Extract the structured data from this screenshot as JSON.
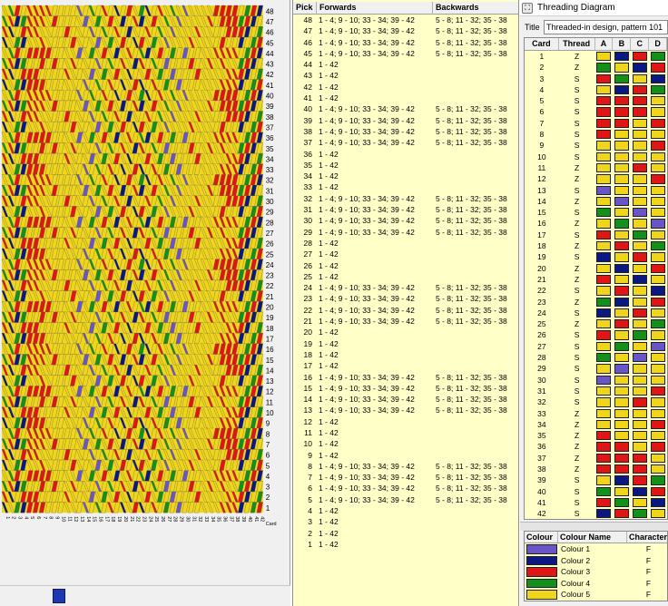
{
  "app": {
    "window_title": "Threading Diagram"
  },
  "colors": {
    "colour_1": "#6a55c8",
    "colour_2": "#0b1782",
    "colour_3": "#e01616",
    "colour_4": "#13901a",
    "colour_5": "#efd61c"
  },
  "pattern": {
    "row_numbers": [
      48,
      47,
      46,
      45,
      44,
      43,
      42,
      41,
      40,
      39,
      38,
      37,
      36,
      35,
      34,
      33,
      32,
      31,
      30,
      29,
      28,
      27,
      26,
      25,
      24,
      23,
      22,
      21,
      20,
      19,
      18,
      17,
      16,
      15,
      14,
      13,
      12,
      11,
      10,
      9,
      8,
      7,
      6,
      5,
      4,
      3,
      2,
      1
    ],
    "card_label": "Card"
  },
  "pick_table": {
    "headers": {
      "pick": "Pick",
      "forwards": "Forwards",
      "backwards": "Backwards"
    },
    "rows": [
      {
        "pick": "48",
        "forwards": "1 - 4; 9 - 10; 33 - 34; 39 - 42",
        "backwards": "5 - 8; 11 - 32; 35 - 38"
      },
      {
        "pick": "47",
        "forwards": "1 - 4; 9 - 10; 33 - 34; 39 - 42",
        "backwards": "5 - 8; 11 - 32; 35 - 38"
      },
      {
        "pick": "46",
        "forwards": "1 - 4; 9 - 10; 33 - 34; 39 - 42",
        "backwards": "5 - 8; 11 - 32; 35 - 38"
      },
      {
        "pick": "45",
        "forwards": "1 - 4; 9 - 10; 33 - 34; 39 - 42",
        "backwards": "5 - 8; 11 - 32; 35 - 38"
      },
      {
        "pick": "44",
        "forwards": "1 - 42",
        "backwards": ""
      },
      {
        "pick": "43",
        "forwards": "1 - 42",
        "backwards": ""
      },
      {
        "pick": "42",
        "forwards": "1 - 42",
        "backwards": ""
      },
      {
        "pick": "41",
        "forwards": "1 - 42",
        "backwards": ""
      },
      {
        "pick": "40",
        "forwards": "1 - 4; 9 - 10; 33 - 34; 39 - 42",
        "backwards": "5 - 8; 11 - 32; 35 - 38"
      },
      {
        "pick": "39",
        "forwards": "1 - 4; 9 - 10; 33 - 34; 39 - 42",
        "backwards": "5 - 8; 11 - 32; 35 - 38"
      },
      {
        "pick": "38",
        "forwards": "1 - 4; 9 - 10; 33 - 34; 39 - 42",
        "backwards": "5 - 8; 11 - 32; 35 - 38"
      },
      {
        "pick": "37",
        "forwards": "1 - 4; 9 - 10; 33 - 34; 39 - 42",
        "backwards": "5 - 8; 11 - 32; 35 - 38"
      },
      {
        "pick": "36",
        "forwards": "1 - 42",
        "backwards": ""
      },
      {
        "pick": "35",
        "forwards": "1 - 42",
        "backwards": ""
      },
      {
        "pick": "34",
        "forwards": "1 - 42",
        "backwards": ""
      },
      {
        "pick": "33",
        "forwards": "1 - 42",
        "backwards": ""
      },
      {
        "pick": "32",
        "forwards": "1 - 4; 9 - 10; 33 - 34; 39 - 42",
        "backwards": "5 - 8; 11 - 32; 35 - 38"
      },
      {
        "pick": "31",
        "forwards": "1 - 4; 9 - 10; 33 - 34; 39 - 42",
        "backwards": "5 - 8; 11 - 32; 35 - 38"
      },
      {
        "pick": "30",
        "forwards": "1 - 4; 9 - 10; 33 - 34; 39 - 42",
        "backwards": "5 - 8; 11 - 32; 35 - 38"
      },
      {
        "pick": "29",
        "forwards": "1 - 4; 9 - 10; 33 - 34; 39 - 42",
        "backwards": "5 - 8; 11 - 32; 35 - 38"
      },
      {
        "pick": "28",
        "forwards": "1 - 42",
        "backwards": ""
      },
      {
        "pick": "27",
        "forwards": "1 - 42",
        "backwards": ""
      },
      {
        "pick": "26",
        "forwards": "1 - 42",
        "backwards": ""
      },
      {
        "pick": "25",
        "forwards": "1 - 42",
        "backwards": ""
      },
      {
        "pick": "24",
        "forwards": "1 - 4; 9 - 10; 33 - 34; 39 - 42",
        "backwards": "5 - 8; 11 - 32; 35 - 38"
      },
      {
        "pick": "23",
        "forwards": "1 - 4; 9 - 10; 33 - 34; 39 - 42",
        "backwards": "5 - 8; 11 - 32; 35 - 38"
      },
      {
        "pick": "22",
        "forwards": "1 - 4; 9 - 10; 33 - 34; 39 - 42",
        "backwards": "5 - 8; 11 - 32; 35 - 38"
      },
      {
        "pick": "21",
        "forwards": "1 - 4; 9 - 10; 33 - 34; 39 - 42",
        "backwards": "5 - 8; 11 - 32; 35 - 38"
      },
      {
        "pick": "20",
        "forwards": "1 - 42",
        "backwards": ""
      },
      {
        "pick": "19",
        "forwards": "1 - 42",
        "backwards": ""
      },
      {
        "pick": "18",
        "forwards": "1 - 42",
        "backwards": ""
      },
      {
        "pick": "17",
        "forwards": "1 - 42",
        "backwards": ""
      },
      {
        "pick": "16",
        "forwards": "1 - 4; 9 - 10; 33 - 34; 39 - 42",
        "backwards": "5 - 8; 11 - 32; 35 - 38"
      },
      {
        "pick": "15",
        "forwards": "1 - 4; 9 - 10; 33 - 34; 39 - 42",
        "backwards": "5 - 8; 11 - 32; 35 - 38"
      },
      {
        "pick": "14",
        "forwards": "1 - 4; 9 - 10; 33 - 34; 39 - 42",
        "backwards": "5 - 8; 11 - 32; 35 - 38"
      },
      {
        "pick": "13",
        "forwards": "1 - 4; 9 - 10; 33 - 34; 39 - 42",
        "backwards": "5 - 8; 11 - 32; 35 - 38"
      },
      {
        "pick": "12",
        "forwards": "1 - 42",
        "backwards": ""
      },
      {
        "pick": "11",
        "forwards": "1 - 42",
        "backwards": ""
      },
      {
        "pick": "10",
        "forwards": "1 - 42",
        "backwards": ""
      },
      {
        "pick": "9",
        "forwards": "1 - 42",
        "backwards": ""
      },
      {
        "pick": "8",
        "forwards": "1 - 4; 9 - 10; 33 - 34; 39 - 42",
        "backwards": "5 - 8; 11 - 32; 35 - 38"
      },
      {
        "pick": "7",
        "forwards": "1 - 4; 9 - 10; 33 - 34; 39 - 42",
        "backwards": "5 - 8; 11 - 32; 35 - 38"
      },
      {
        "pick": "6",
        "forwards": "1 - 4; 9 - 10; 33 - 34; 39 - 42",
        "backwards": "5 - 8; 11 - 32; 35 - 38"
      },
      {
        "pick": "5",
        "forwards": "1 - 4; 9 - 10; 33 - 34; 39 - 42",
        "backwards": "5 - 8; 11 - 32; 35 - 38"
      },
      {
        "pick": "4",
        "forwards": "1 - 42",
        "backwards": ""
      },
      {
        "pick": "3",
        "forwards": "1 - 42",
        "backwards": ""
      },
      {
        "pick": "2",
        "forwards": "1 - 42",
        "backwards": ""
      },
      {
        "pick": "1",
        "forwards": "1 - 42",
        "backwards": ""
      }
    ]
  },
  "threading": {
    "title_label": "Title",
    "title_value": "Threaded-in design, pattern 101",
    "headers": {
      "card": "Card",
      "thread": "Thread",
      "a": "A",
      "b": "B",
      "c": "C",
      "d": "D"
    },
    "cards": [
      {
        "card": "1",
        "thread": "Z",
        "holes": [
          5,
          2,
          3,
          4
        ]
      },
      {
        "card": "2",
        "thread": "Z",
        "holes": [
          4,
          5,
          2,
          3
        ]
      },
      {
        "card": "3",
        "thread": "S",
        "holes": [
          3,
          4,
          5,
          2
        ]
      },
      {
        "card": "4",
        "thread": "S",
        "holes": [
          5,
          2,
          3,
          4
        ]
      },
      {
        "card": "5",
        "thread": "S",
        "holes": [
          3,
          3,
          3,
          5
        ]
      },
      {
        "card": "6",
        "thread": "S",
        "holes": [
          3,
          3,
          3,
          5
        ]
      },
      {
        "card": "7",
        "thread": "S",
        "holes": [
          3,
          3,
          5,
          3
        ]
      },
      {
        "card": "8",
        "thread": "S",
        "holes": [
          3,
          5,
          5,
          5
        ]
      },
      {
        "card": "9",
        "thread": "S",
        "holes": [
          5,
          5,
          5,
          3
        ]
      },
      {
        "card": "10",
        "thread": "S",
        "holes": [
          5,
          5,
          5,
          5
        ]
      },
      {
        "card": "11",
        "thread": "Z",
        "holes": [
          5,
          5,
          3,
          5
        ]
      },
      {
        "card": "12",
        "thread": "Z",
        "holes": [
          5,
          5,
          5,
          3
        ]
      },
      {
        "card": "13",
        "thread": "S",
        "holes": [
          1,
          5,
          5,
          5
        ]
      },
      {
        "card": "14",
        "thread": "Z",
        "holes": [
          5,
          1,
          5,
          5
        ]
      },
      {
        "card": "15",
        "thread": "S",
        "holes": [
          4,
          5,
          1,
          5
        ]
      },
      {
        "card": "16",
        "thread": "Z",
        "holes": [
          5,
          4,
          5,
          1
        ]
      },
      {
        "card": "17",
        "thread": "S",
        "holes": [
          3,
          5,
          4,
          5
        ]
      },
      {
        "card": "18",
        "thread": "Z",
        "holes": [
          5,
          3,
          5,
          4
        ]
      },
      {
        "card": "19",
        "thread": "S",
        "holes": [
          2,
          5,
          3,
          5
        ]
      },
      {
        "card": "20",
        "thread": "Z",
        "holes": [
          5,
          2,
          5,
          3
        ]
      },
      {
        "card": "21",
        "thread": "Z",
        "holes": [
          3,
          5,
          2,
          5
        ]
      },
      {
        "card": "22",
        "thread": "S",
        "holes": [
          5,
          3,
          5,
          2
        ]
      },
      {
        "card": "23",
        "thread": "Z",
        "holes": [
          4,
          2,
          5,
          3
        ]
      },
      {
        "card": "24",
        "thread": "S",
        "holes": [
          2,
          5,
          3,
          5
        ]
      },
      {
        "card": "25",
        "thread": "Z",
        "holes": [
          5,
          3,
          5,
          4
        ]
      },
      {
        "card": "26",
        "thread": "S",
        "holes": [
          3,
          5,
          4,
          5
        ]
      },
      {
        "card": "27",
        "thread": "S",
        "holes": [
          5,
          4,
          5,
          1
        ]
      },
      {
        "card": "28",
        "thread": "S",
        "holes": [
          4,
          5,
          1,
          5
        ]
      },
      {
        "card": "29",
        "thread": "S",
        "holes": [
          5,
          1,
          5,
          5
        ]
      },
      {
        "card": "30",
        "thread": "S",
        "holes": [
          1,
          5,
          5,
          5
        ]
      },
      {
        "card": "31",
        "thread": "S",
        "holes": [
          5,
          5,
          5,
          3
        ]
      },
      {
        "card": "32",
        "thread": "S",
        "holes": [
          5,
          5,
          3,
          5
        ]
      },
      {
        "card": "33",
        "thread": "Z",
        "holes": [
          5,
          5,
          5,
          5
        ]
      },
      {
        "card": "34",
        "thread": "Z",
        "holes": [
          5,
          5,
          5,
          3
        ]
      },
      {
        "card": "35",
        "thread": "Z",
        "holes": [
          3,
          5,
          5,
          5
        ]
      },
      {
        "card": "36",
        "thread": "Z",
        "holes": [
          3,
          3,
          5,
          3
        ]
      },
      {
        "card": "37",
        "thread": "Z",
        "holes": [
          3,
          3,
          3,
          5
        ]
      },
      {
        "card": "38",
        "thread": "Z",
        "holes": [
          3,
          3,
          3,
          5
        ]
      },
      {
        "card": "39",
        "thread": "S",
        "holes": [
          5,
          2,
          3,
          4
        ]
      },
      {
        "card": "40",
        "thread": "S",
        "holes": [
          4,
          5,
          2,
          3
        ]
      },
      {
        "card": "41",
        "thread": "S",
        "holes": [
          3,
          4,
          5,
          2
        ]
      },
      {
        "card": "42",
        "thread": "S",
        "holes": [
          2,
          3,
          4,
          5
        ]
      }
    ]
  },
  "colour_table": {
    "headers": {
      "colour": "Colour",
      "name": "Colour Name",
      "character": "Character"
    },
    "rows": [
      {
        "swatch": "colour_1",
        "name": "Colour 1",
        "character": "F"
      },
      {
        "swatch": "colour_2",
        "name": "Colour 2",
        "character": "F"
      },
      {
        "swatch": "colour_3",
        "name": "Colour 3",
        "character": "F"
      },
      {
        "swatch": "colour_4",
        "name": "Colour 4",
        "character": "F"
      },
      {
        "swatch": "colour_5",
        "name": "Colour 5",
        "character": "F"
      }
    ]
  }
}
